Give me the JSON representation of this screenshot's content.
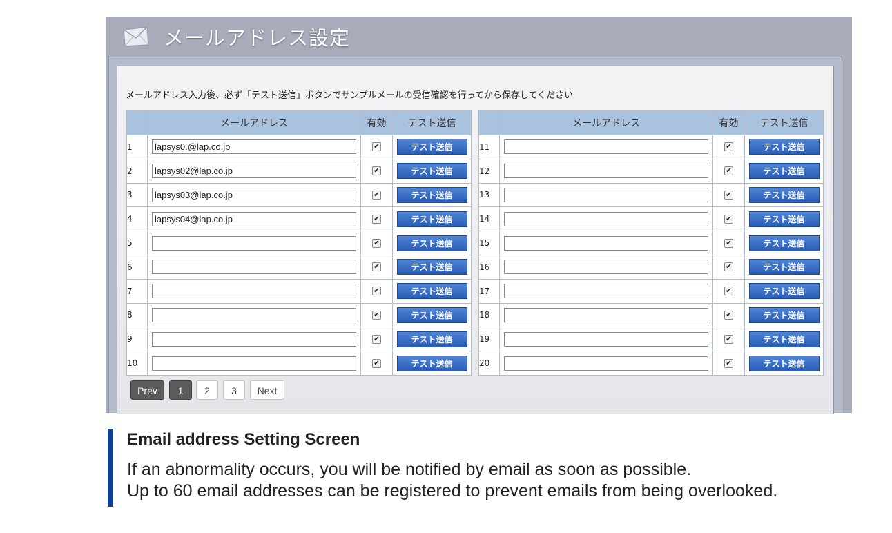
{
  "window": {
    "title": "メールアドレス設定",
    "instruction": "メールアドレス入力後、必ず「テスト送信」ボタンでサンプルメールの受信確認を行ってから保存してください"
  },
  "table_headers": {
    "address": "メールアドレス",
    "valid": "有効",
    "test_send": "テスト送信"
  },
  "send_button_label": "テスト送信",
  "left_rows": [
    {
      "num": "1",
      "address": "lapsys0.@lap.co.jp",
      "valid": true
    },
    {
      "num": "2",
      "address": "lapsys02@lap.co.jp",
      "valid": true
    },
    {
      "num": "3",
      "address": "lapsys03@lap.co.jp",
      "valid": true
    },
    {
      "num": "4",
      "address": "lapsys04@lap.co.jp",
      "valid": true
    },
    {
      "num": "5",
      "address": "",
      "valid": true
    },
    {
      "num": "6",
      "address": "",
      "valid": true
    },
    {
      "num": "7",
      "address": "",
      "valid": true
    },
    {
      "num": "8",
      "address": "",
      "valid": true
    },
    {
      "num": "9",
      "address": "",
      "valid": true
    },
    {
      "num": "10",
      "address": "",
      "valid": true
    }
  ],
  "right_rows": [
    {
      "num": "11",
      "address": "",
      "valid": true
    },
    {
      "num": "12",
      "address": "",
      "valid": true
    },
    {
      "num": "13",
      "address": "",
      "valid": true
    },
    {
      "num": "14",
      "address": "",
      "valid": true
    },
    {
      "num": "15",
      "address": "",
      "valid": true
    },
    {
      "num": "16",
      "address": "",
      "valid": true
    },
    {
      "num": "17",
      "address": "",
      "valid": true
    },
    {
      "num": "18",
      "address": "",
      "valid": true
    },
    {
      "num": "19",
      "address": "",
      "valid": true
    },
    {
      "num": "20",
      "address": "",
      "valid": true
    }
  ],
  "pagination": {
    "prev": "Prev",
    "pages": [
      "1",
      "2",
      "3"
    ],
    "current": "1",
    "next": "Next"
  },
  "caption": {
    "title": "Email address Setting Screen",
    "line1": "If an abnormality occurs, you will be notified by email as soon as possible.",
    "line2": "Up to 60 email addresses can be registered to prevent emails from being overlooked."
  },
  "colors": {
    "header_bg": "#a9c2de",
    "send_button": "#3a6fc8",
    "caption_bar": "#0d3f8e",
    "window_bg": "#a9adbb"
  }
}
